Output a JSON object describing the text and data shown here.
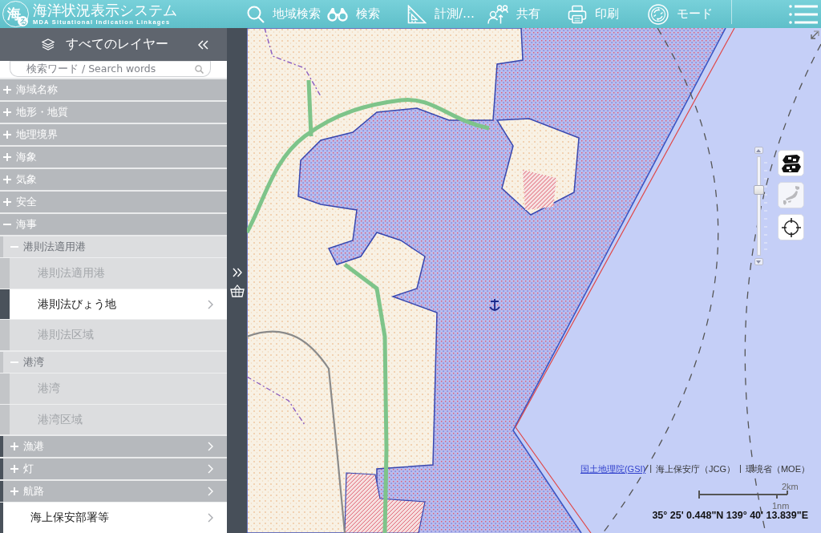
{
  "header": {
    "logo": {
      "mark": "海",
      "badge": "る"
    },
    "title": "海洋状況表示システム",
    "subtitle": "MDA Situational Indication Linkages",
    "tools": [
      "地域検索",
      "検索",
      "計測/…",
      "共有",
      "印刷",
      "モード"
    ]
  },
  "sidebar": {
    "title": "すべてのレイヤー",
    "search": {
      "placeholder": "検索ワード / Search words"
    },
    "layers": [
      {
        "kind": "group",
        "label": "海域名称",
        "expanded": false,
        "chevron": false
      },
      {
        "kind": "group",
        "label": "地形・地質",
        "expanded": false,
        "chevron": false
      },
      {
        "kind": "group",
        "label": "地理境界",
        "expanded": false,
        "chevron": false
      },
      {
        "kind": "group",
        "label": "海象",
        "expanded": false,
        "chevron": false
      },
      {
        "kind": "group",
        "label": "気象",
        "expanded": false,
        "chevron": false
      },
      {
        "kind": "group",
        "label": "安全",
        "expanded": false,
        "chevron": false
      },
      {
        "kind": "group",
        "label": "海事",
        "expanded": true,
        "chevron": false,
        "children": [
          {
            "kind": "group",
            "label": "港則法適用港",
            "expanded": true,
            "chevron": false,
            "children": [
              {
                "kind": "layer",
                "label": "港則法適用港",
                "on": false,
                "chevron": false
              },
              {
                "kind": "layer",
                "label": "港則法びょう地",
                "on": true,
                "chevron": true
              },
              {
                "kind": "layer",
                "label": "港則法区域",
                "on": false,
                "chevron": false
              }
            ]
          },
          {
            "kind": "group",
            "label": "港湾",
            "expanded": true,
            "chevron": false,
            "children": [
              {
                "kind": "layer",
                "label": "港湾",
                "on": false,
                "chevron": false
              },
              {
                "kind": "layer",
                "label": "港湾区域",
                "on": false,
                "chevron": false
              }
            ]
          },
          {
            "kind": "group",
            "label": "漁港",
            "expanded": false,
            "chevron": true
          },
          {
            "kind": "group",
            "label": "灯",
            "expanded": false,
            "chevron": true
          },
          {
            "kind": "group",
            "label": "航路",
            "expanded": false,
            "chevron": true
          },
          {
            "kind": "layer",
            "label": "海上保安部署等",
            "on": true,
            "chevron": true
          }
        ]
      }
    ]
  },
  "map": {
    "zoom_slider": {
      "level": 0.67
    },
    "buttons": [
      {
        "disabled": false
      },
      {
        "disabled": true
      },
      {
        "disabled": false
      }
    ],
    "attribution": {
      "separator": "|",
      "items": [
        {
          "text": "国土地理院(GSI)",
          "link": true
        },
        {
          "text": "海上保安庁（JCG）",
          "link": false
        },
        {
          "text": "環境省（MOE）",
          "link": false
        }
      ]
    },
    "scale": {
      "upper": "2km",
      "lower": "1nm"
    },
    "coordinates": "35° 25' 0.448\"N 139° 40' 13.839\"E"
  }
}
